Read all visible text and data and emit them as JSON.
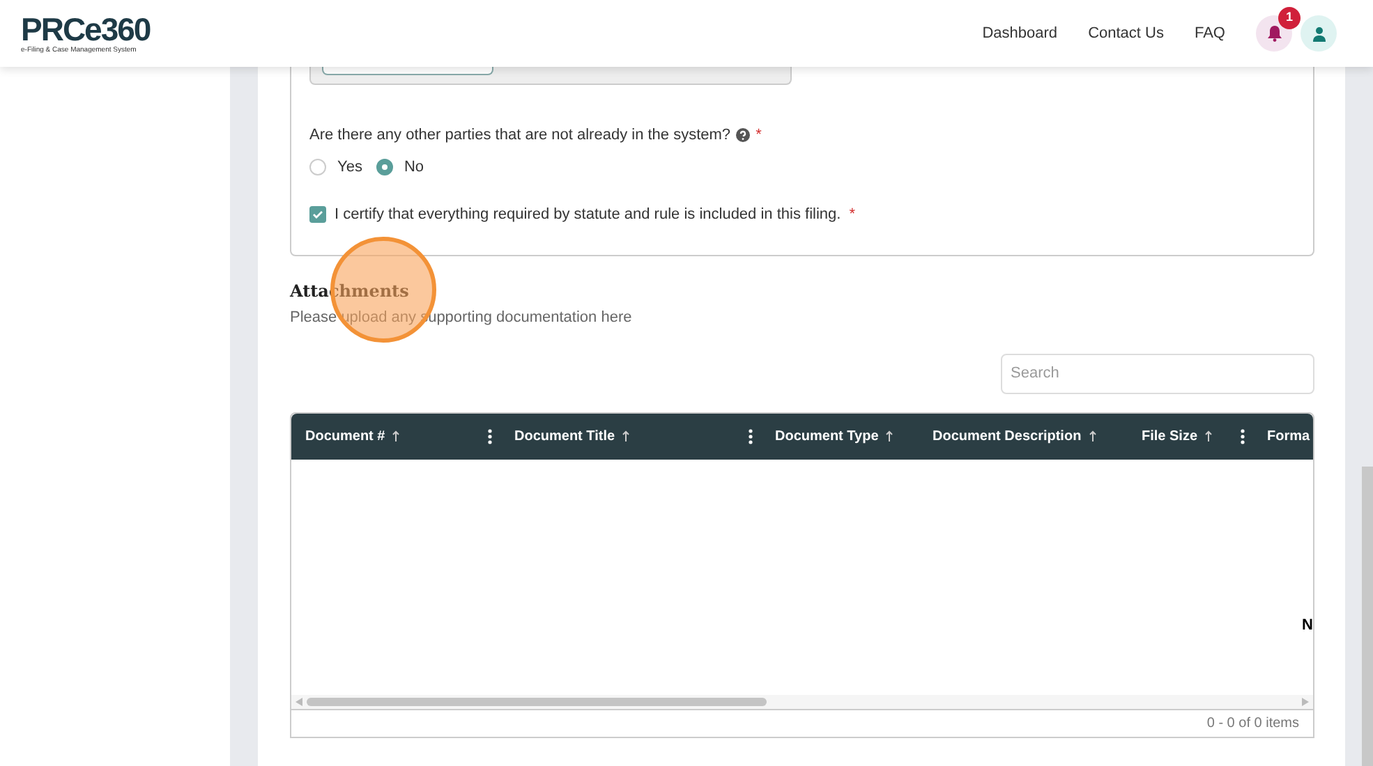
{
  "header": {
    "logo": "PRCe360",
    "tagline": "e-Filing & Case Management System",
    "nav": [
      {
        "label": "Dashboard"
      },
      {
        "label": "Contact Us"
      },
      {
        "label": "FAQ"
      }
    ],
    "notification_count": "1"
  },
  "question": {
    "label": "Are there any other parties that are not already in the system?",
    "required": "*",
    "options": [
      {
        "label": "Yes",
        "selected": false
      },
      {
        "label": "No",
        "selected": true
      }
    ]
  },
  "certify": {
    "label": "I certify that everything required by statute and rule is included in this filing.",
    "required": "*",
    "checked": true
  },
  "attachments": {
    "title": "Attachments",
    "subtitle": "Please upload any supporting documentation here",
    "search": {
      "placeholder": "Search"
    },
    "columns": [
      {
        "label": "Document #",
        "menu": true
      },
      {
        "label": "Document Title",
        "menu": true
      },
      {
        "label": "Document Type",
        "menu": false
      },
      {
        "label": "Document Description",
        "menu": false
      },
      {
        "label": "File Size",
        "menu": true
      },
      {
        "label": "Forma",
        "menu": false
      }
    ],
    "empty_text": "N",
    "pager": "0 - 0 of 0 items"
  }
}
